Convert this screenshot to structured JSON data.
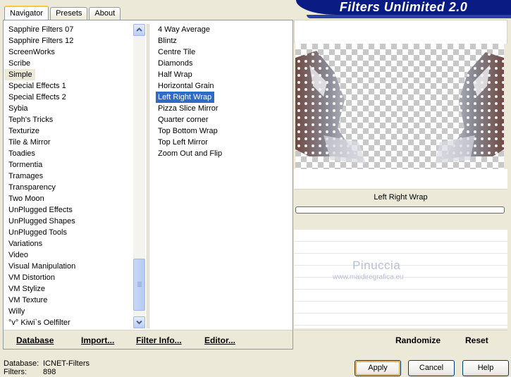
{
  "tabs": [
    "Navigator",
    "Presets",
    "About"
  ],
  "banner_title": "Filters Unlimited 2.0",
  "categories": [
    "Sapphire Filters 07",
    "Sapphire Filters 12",
    "ScreenWorks",
    "Scribe",
    "Simple",
    "Special Effects 1",
    "Special Effects 2",
    "Sybia",
    "Teph's Tricks",
    "Texturize",
    "Tile & Mirror",
    "Toadies",
    "Tormentia",
    "Tramages",
    "Transparency",
    "Two Moon",
    "UnPlugged Effects",
    "UnPlugged Shapes",
    "UnPlugged Tools",
    "Variations",
    "Video",
    "Visual Manipulation",
    "VM Distortion",
    "VM Stylize",
    "VM Texture",
    "Willy",
    "°v° Kiwi`s Oelfilter"
  ],
  "selected_category": "Simple",
  "scrollbar": {
    "thumb_position": 0.86
  },
  "filters": [
    "4 Way Average",
    "Blintz",
    "Centre Tile",
    "Diamonds",
    "Half Wrap",
    "Horizontal Grain",
    "Left Right Wrap",
    "Pizza Slice Mirror",
    "Quarter corner",
    "Top Bottom Wrap",
    "Top Left Mirror",
    "Zoom Out and Flip"
  ],
  "selected_filter": "Left Right Wrap",
  "left_buttons": {
    "database": "Database",
    "import": "Import...",
    "filter_info": "Filter Info...",
    "editor": "Editor..."
  },
  "preview": {
    "filter_name": "Left Right Wrap",
    "progress": 0
  },
  "watermark": {
    "name": "Pinuccia",
    "url": "www.maidiregrafica.eu"
  },
  "right_buttons": {
    "randomize": "Randomize",
    "reset": "Reset"
  },
  "status": {
    "database_label": "Database:",
    "database_value": "ICNET-Filters",
    "filters_label": "Filters:",
    "filters_value": "898"
  },
  "dialog_buttons": {
    "apply": "Apply",
    "cancel": "Cancel",
    "help": "Help"
  }
}
